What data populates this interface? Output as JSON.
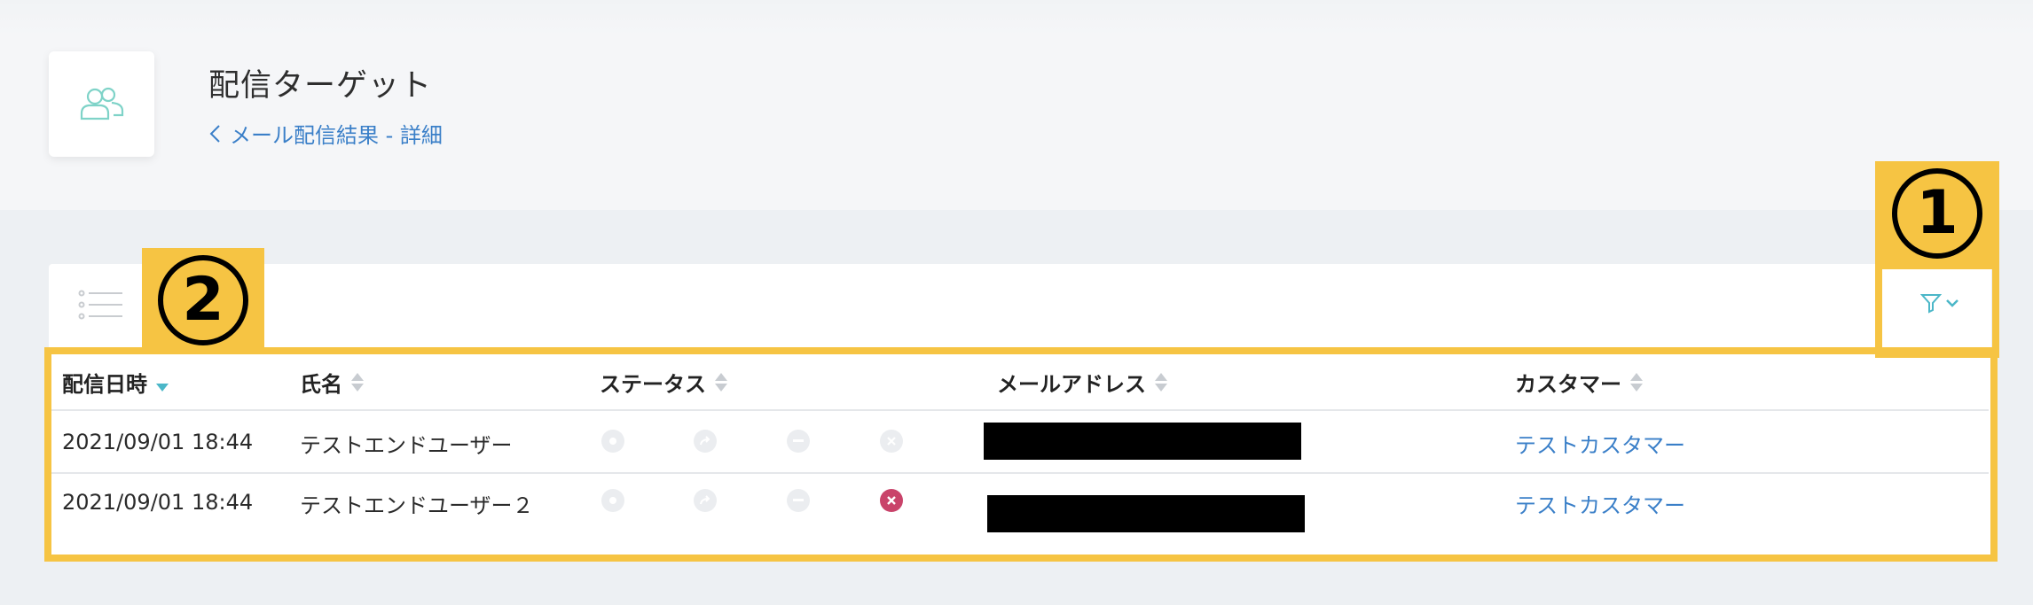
{
  "header": {
    "title": "配信ターゲット",
    "breadcrumb": "メール配信結果 - 詳細",
    "icon": "users-icon"
  },
  "toolbar": {
    "list_icon": "list-icon",
    "filter_icon": "filter-icon",
    "dropdown_icon": "chevron-down-icon"
  },
  "annotations": {
    "one": "①",
    "two": "②",
    "highlight_color": "#f6c443"
  },
  "table": {
    "columns": [
      "配信日時",
      "氏名",
      "ステータス",
      "メールアドレス",
      "カスタマー"
    ],
    "rows": [
      {
        "date": "2021/09/01 18:44",
        "name": "テストエンドユーザー",
        "statuses": [
          "sent",
          "forwarded",
          "unsubscribed",
          "error-inactive"
        ],
        "email": "[redacted]",
        "customer": "テストカスタマー"
      },
      {
        "date": "2021/09/01 18:44",
        "name": "テストエンドユーザー２",
        "statuses": [
          "sent",
          "forwarded",
          "unsubscribed",
          "error-active"
        ],
        "email": "[redacted]",
        "customer": "テストカスタマー"
      }
    ]
  },
  "colors": {
    "link": "#3a7fc8",
    "error": "#c9436a",
    "sort_active": "#4bb7c8",
    "accent": "#7fd3c8"
  }
}
